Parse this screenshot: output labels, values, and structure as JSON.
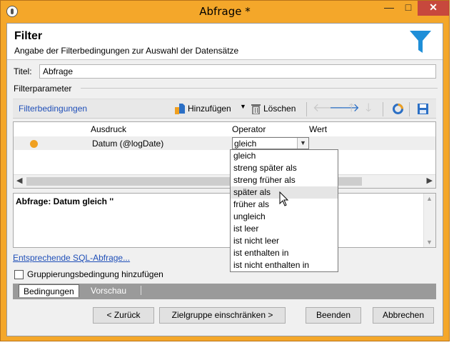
{
  "window": {
    "title": "Abfrage *",
    "minimize": "—",
    "maximize": "□",
    "close": "✕"
  },
  "header": {
    "title": "Filter",
    "subtitle": "Angabe der Filterbedingungen zur Auswahl der Datensätze",
    "icon": "funnel-icon"
  },
  "title_field": {
    "label": "Titel:",
    "value": "Abfrage"
  },
  "section": {
    "label": "Filterparameter"
  },
  "toolbar": {
    "filter_label": "Filterbedingungen",
    "add_label": "Hinzufügen",
    "delete_label": "Löschen"
  },
  "grid": {
    "columns": [
      "Ausdruck",
      "Operator",
      "Wert"
    ],
    "row": {
      "expression": "Datum (@logDate)",
      "operator": "gleich",
      "value": ""
    }
  },
  "query": {
    "text": "Abfrage: Datum gleich ''"
  },
  "sql_link": "Entsprechende SQL-Abfrage...",
  "group_check": {
    "label": "Gruppierungsbedingung hinzufügen",
    "checked": false
  },
  "tabs": [
    {
      "label": "Bedingungen",
      "active": true
    },
    {
      "label": "Vorschau",
      "active": false
    }
  ],
  "buttons": {
    "back": "< Zurück",
    "restrict": "Zielgruppe einschränken >",
    "finish": "Beenden",
    "cancel": "Abbrechen"
  },
  "operator_options": [
    "gleich",
    "streng später als",
    "streng früher als",
    "später als",
    "früher als",
    "ungleich",
    "ist leer",
    "ist nicht leer",
    "ist enthalten in",
    "ist nicht enthalten in"
  ],
  "operator_hover_index": 3,
  "colors": {
    "window_frame": "#f4a72a",
    "accent_blue": "#1f8fd8",
    "link": "#1f4fb8",
    "close": "#c7483d"
  }
}
